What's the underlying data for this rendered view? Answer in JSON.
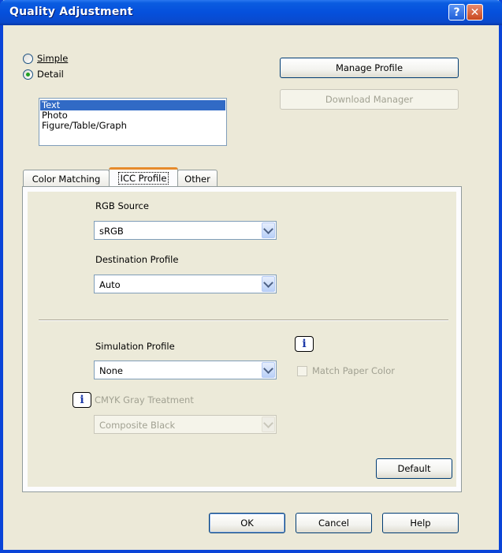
{
  "window": {
    "title": "Quality Adjustment",
    "help_glyph": "?",
    "close_glyph": "✕"
  },
  "mode": {
    "simple_label": "Simple",
    "detail_label": "Detail",
    "selected": "Detail"
  },
  "object_list": {
    "items": [
      "Text",
      "Photo",
      "Figure/Table/Graph"
    ],
    "selected_index": 0
  },
  "buttons": {
    "manage_profile": "Manage Profile",
    "download_manager": "Download Manager",
    "default": "Default",
    "ok": "OK",
    "cancel": "Cancel",
    "help": "Help"
  },
  "tabs": [
    {
      "label": "Color Matching",
      "active": false
    },
    {
      "label": "ICC Profile",
      "active": true
    },
    {
      "label": "Other",
      "active": false
    }
  ],
  "icc": {
    "rgb_source_label": "RGB Source",
    "rgb_source_value": "sRGB",
    "destination_label": "Destination Profile",
    "destination_value": "Auto",
    "simulation_label": "Simulation Profile",
    "simulation_value": "None",
    "match_paper_label": "Match Paper Color",
    "cmyk_gray_label": "CMYK Gray Treatment",
    "cmyk_gray_value": "Composite Black"
  },
  "icons": {
    "info_glyph": "i"
  },
  "colors": {
    "title_bar": "#0a5ce0",
    "selection": "#316ac5",
    "active_tab_accent": "#e68b2c"
  }
}
